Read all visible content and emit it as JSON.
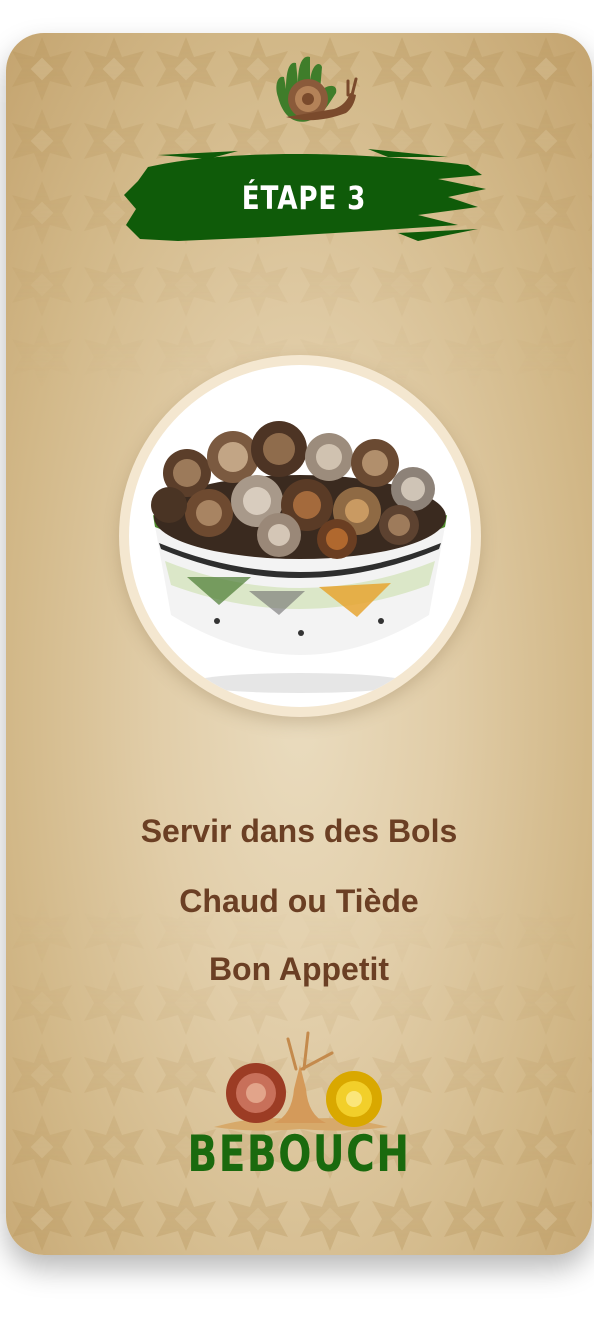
{
  "step": {
    "title": "ÉTAPE 3"
  },
  "photo": {
    "subject": "bowl-of-snails"
  },
  "instructions": {
    "line1": "Servir dans des Bols",
    "line2": "Chaud ou Tiède",
    "line3": "Bon Appetit"
  },
  "brand": {
    "name": "BEBOUCH"
  },
  "colors": {
    "card_light": "#eadcbf",
    "card_dark": "#c4a46f",
    "banner_green": "#0f5b09",
    "brand_green": "#1a6a0e",
    "text_brown": "#6b3f24"
  },
  "icons": [
    "hand-snail-logo-icon",
    "two-snails-icon"
  ]
}
